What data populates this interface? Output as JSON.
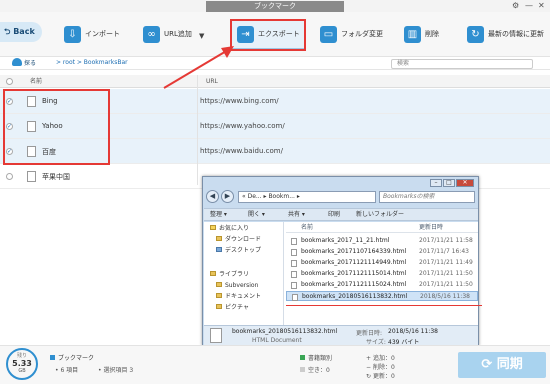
{
  "app": {
    "title": "ブックマーク",
    "window_controls": [
      "⚙",
      "—",
      "✕"
    ]
  },
  "toolbar": {
    "back": "Back",
    "import": "インポート",
    "add_url": "URL追加",
    "dropdown": "▼",
    "export": "エクスポート",
    "folder_change": "フォルダ変更",
    "delete": "削除",
    "update": "最新の情報に更新"
  },
  "pathbar": {
    "share": "探る",
    "breadcrumb": "> root > BookmarksBar",
    "search_placeholder": "検索"
  },
  "table": {
    "headers": {
      "name": "名前",
      "url": "URL"
    },
    "rows": [
      {
        "name": "Bing",
        "url": "https://www.bing.com/",
        "checked": true
      },
      {
        "name": "Yahoo",
        "url": "https://www.yahoo.com/",
        "checked": true
      },
      {
        "name": "百度",
        "url": "https://www.baidu.com/",
        "checked": true
      },
      {
        "name": "苹果中国",
        "url": "",
        "checked": false
      }
    ]
  },
  "dialog": {
    "address": "« De... ▸ Bookm... ▸",
    "search_placeholder": "Bookmarksの検索",
    "tools": [
      "整理 ▾",
      "開く ▾",
      "共有 ▾",
      "印刷",
      "新しいフォルダー"
    ],
    "sidebar": [
      "お気に入り",
      "ダウンロード",
      "デスクトップ",
      "ライブラリ",
      "Subversion",
      "ドキュメント",
      "ピクチャ"
    ],
    "headers": {
      "name": "名前",
      "date": "更新日時"
    },
    "files": [
      {
        "name": "bookmarks_2017_11_21.html",
        "date": "2017/11/21 11:58"
      },
      {
        "name": "bookmarks_20171107164339.html",
        "date": "2017/11/7 16:43"
      },
      {
        "name": "bookmarks_20171121114949.html",
        "date": "2017/11/21 11:49"
      },
      {
        "name": "bookmarks_20171121115014.html",
        "date": "2017/11/21 11:50"
      },
      {
        "name": "bookmarks_20171121115024.html",
        "date": "2017/11/21 11:50"
      },
      {
        "name": "bookmarks_20180516113832.html",
        "date": "2018/5/16 11:38"
      }
    ],
    "status": {
      "filename": "bookmarks_20180516113832.html",
      "modified_label": "更新日時:",
      "modified": "2018/5/16 11:38",
      "type": "HTML Document",
      "size_label": "サイズ:",
      "size": "439 バイト"
    }
  },
  "bottom": {
    "disk_label": "残り",
    "disk_value": "5.33",
    "disk_unit": "GB",
    "category": "ブックマーク",
    "items": "6 項目",
    "selected": "選択項目 3",
    "legend_bookmark": "書籍類別",
    "legend_free": "空き：0",
    "add_label": "追加：0",
    "del_label": "削除：0",
    "upd_label": "更新：0",
    "sync": "同期"
  },
  "colors": {
    "accent": "#2f8fd0",
    "highlight": "#e53935",
    "sync": "#a9d3ef"
  }
}
